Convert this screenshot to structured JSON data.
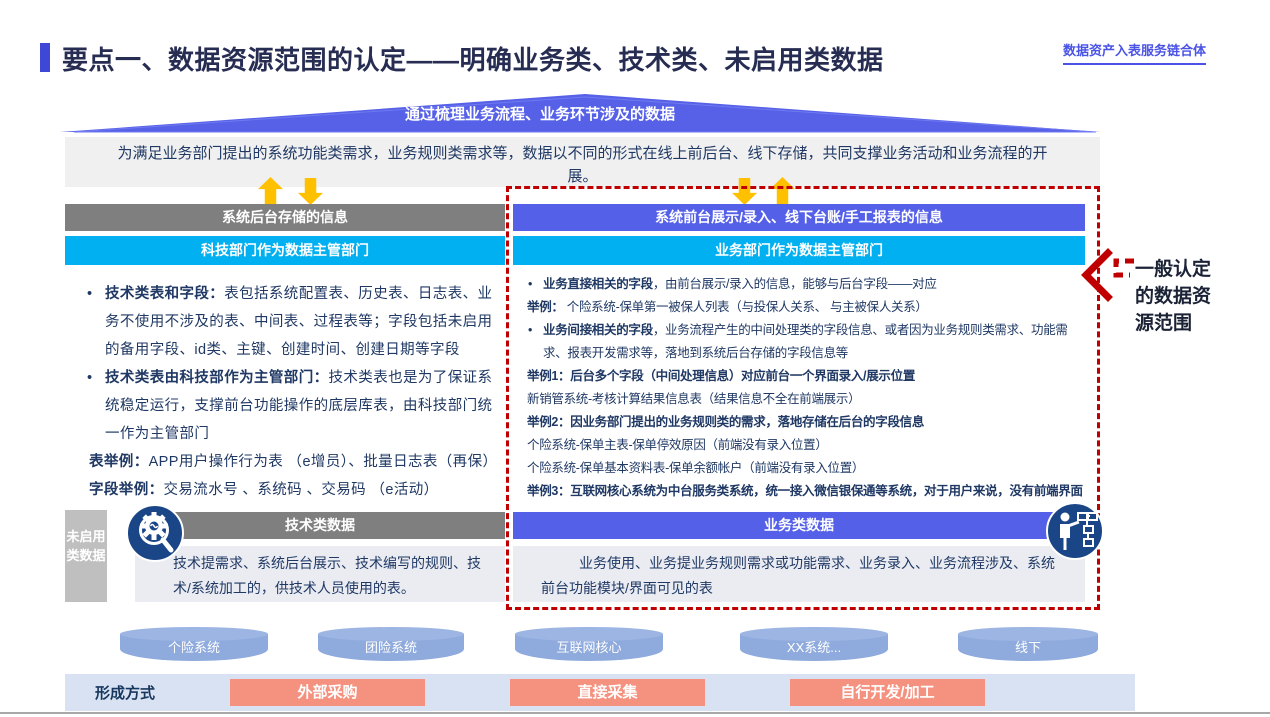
{
  "header": {
    "title": "要点一、数据资源范围的认定——明确业务类、技术类、未启用类数据",
    "corner_tag": "数据资产入表服务链合体"
  },
  "funnel_label": "通过梳理业务流程、业务环节涉及的数据",
  "intro_text": "为满足业务部门提出的系统功能类需求，业务规则类需求等，数据以不同的形式在线上前后台、线下存储，共同支撑业务活动和业务流程的开展。",
  "left_panel": {
    "header": "系统后台存储的信息",
    "subheader": "科技部门作为数据主管部门",
    "bullets": [
      {
        "label": "技术类表和字段：",
        "text": "表包括系统配置表、历史表、日志表、业务不使用不涉及的表、中间表、过程表等；字段包括未启用的备用字段、id类、主键、创建时间、创建日期等字段"
      },
      {
        "label": "技术类表由科技部作为主管部门：",
        "text": "技术类表也是为了保证系统稳定运行，支撑前台功能操作的底层库表，由科技部门统一作为主管部门"
      }
    ],
    "examples": [
      {
        "label": "表举例：",
        "text": "APP用户操作行为表 （e增员）、批量日志表（再保）"
      },
      {
        "label": "字段举例：",
        "text": "交易流水号 、系统码 、交易码 （e活动）"
      }
    ]
  },
  "right_panel": {
    "header": "系统前台展示/录入、线下台账/手工报表的信息",
    "subheader": "业务部门作为数据主管部门",
    "lines": [
      {
        "label": "业务直接相关的字段",
        "text": "，由前台展示/录入的信息，能够与后台字段——对应"
      },
      {
        "label": "举例：",
        "text": " 个险系统-保单第一被保人列表（与投保人关系、 与主被保人关系）"
      },
      {
        "label": "业务间接相关的字段",
        "text": "，业务流程产生的中间处理类的字段信息、或者因为业务规则类需求、功能需求、报表开发需求等，落地到系统后台存储的字段信息等"
      },
      {
        "label": "举例1：后台多个字段（中间处理信息）对应前台一个界面录入/展示位置",
        "text": ""
      },
      {
        "label": "",
        "text": "新销管系统-考核计算结果信息表（结果信息不全在前端展示）"
      },
      {
        "label": "举例2：因业务部门提出的业务规则类的需求，落地存储在后台的字段信息",
        "text": ""
      },
      {
        "label": "",
        "text": "个险系统-保单主表-保单停效原因（前端没有录入位置）"
      },
      {
        "label": "",
        "text": "个险系统-保单基本资料表-保单余额帐户（前端没有录入位置）"
      },
      {
        "label": "举例3：互联网核心系统为中台服务类系统，统一接入微信银保通等系统，对于用户来说，没有前端界面",
        "text": ""
      }
    ]
  },
  "categories": {
    "unused_label": "未启用类数据",
    "tech": {
      "bar": "技术类数据",
      "desc": "技术提需求、系统后台展示、技术编写的规则、技术/系统加工的，供技术人员使用的表。",
      "icon": "gear-magnifier-icon"
    },
    "business": {
      "bar": "业务类数据",
      "desc": "业务使用、业务提业务规则需求或功能需求、业务录入、业务流程涉及、系统前台功能模块/界面可见的表",
      "icon": "person-orgchart-icon"
    }
  },
  "annotation": "一般认定的数据资源范围",
  "systems": [
    "个险系统",
    "团险系统",
    "互联网核心",
    "XX系统...",
    "线下"
  ],
  "formation": {
    "label": "形成方式",
    "methods": [
      "外部采购",
      "直接采集",
      "自行开发/加工"
    ]
  },
  "colors": {
    "accent_blue": "#5560E8",
    "cyan": "#00B0F0",
    "gray_bar": "#7F7F7F",
    "navy_text": "#1F3864",
    "red_dashed": "#C00000",
    "arrow_yellow": "#FFC000",
    "salmon": "#F4917F",
    "cylinder_blue": "#8FAADC",
    "formation_bg": "#D9E2F3",
    "icon_circle": "#1A4688"
  }
}
